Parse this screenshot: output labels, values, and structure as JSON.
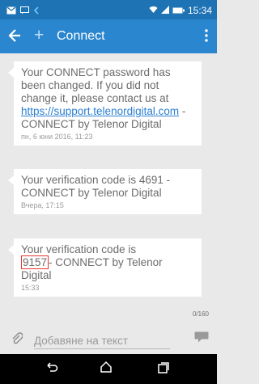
{
  "status": {
    "time": "15:34"
  },
  "header": {
    "title": "Connect"
  },
  "messages": [
    {
      "text_before": "Your CONNECT password has been changed. If you did not change it, please contact us at ",
      "link": "https://support.telenordigital.com",
      "text_after": " - CONNECT by Telenor Digital",
      "time": "пн, 6 юни 2016, 11:23"
    },
    {
      "text": "Your verification code is 4691 - CONNECT by Telenor Digital",
      "time": "Вчера, 17:15"
    },
    {
      "text_before": "Your verification code is ",
      "code": "9157",
      "text_after": "- CONNECT by Telenor Digital",
      "time": "15:33"
    }
  ],
  "compose": {
    "counter": "0/160",
    "placeholder": "Добавяне на текст"
  },
  "colors": {
    "status_bar": "#1e73b4",
    "app_bar": "#2a86cf",
    "background": "#e9e9e9",
    "code_highlight": "#e5322e"
  }
}
